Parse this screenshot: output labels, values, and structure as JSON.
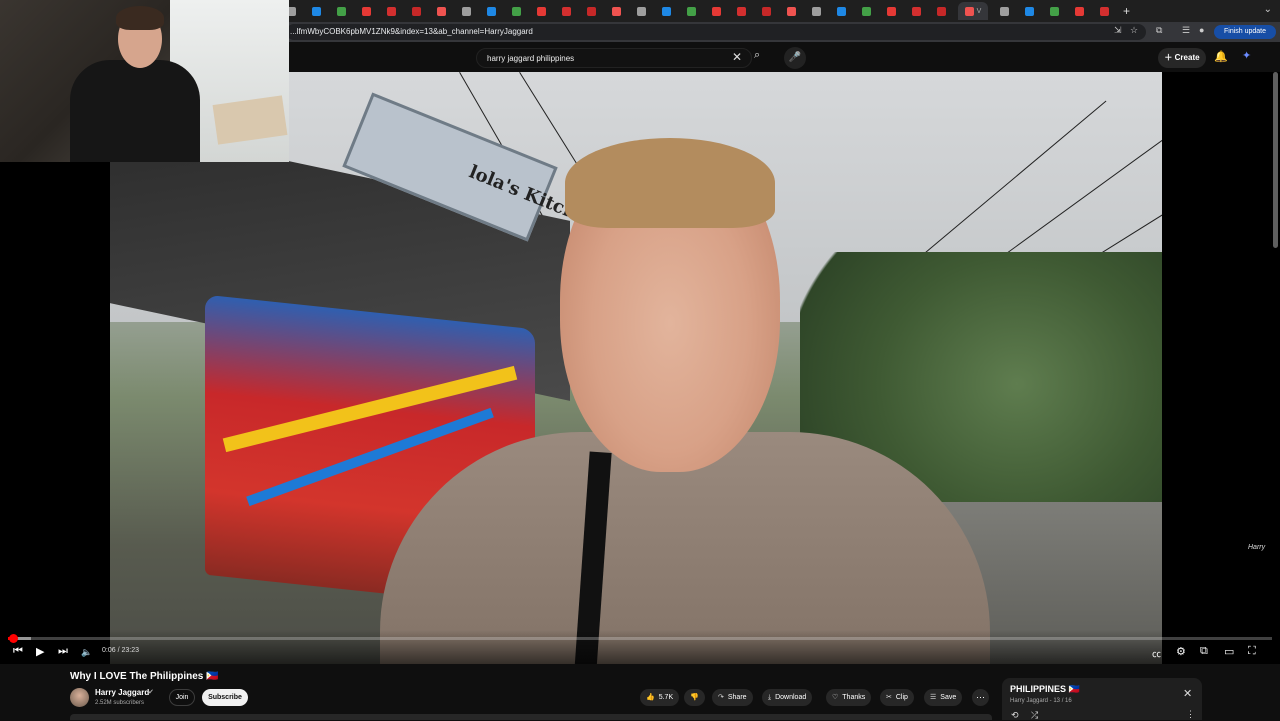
{
  "browser": {
    "tab_count": 44,
    "active_tab_letter": "V",
    "url": "...lfmWbyCOBK6pbMV1ZNk9&index=13&ab_channel=HarryJaggard",
    "finish_update_label": "Finish update"
  },
  "youtube": {
    "search_query": "harry jaggard philippines",
    "create_label": "Create"
  },
  "player": {
    "time_display": "0:06 / 23:23",
    "progress_fraction": 0.0043,
    "buffer_fraction": 0.018,
    "watermark": "Harry",
    "scene_sign_text": "lola's Kitchen & restaurant"
  },
  "video": {
    "title": "Why I LOVE The Philippines 🇵🇭",
    "channel_name": "Harry Jaggard",
    "verified_icon": "verified-check-icon",
    "subscribers": "2.52M subscribers",
    "join_label": "Join",
    "subscribe_label": "Subscribe",
    "like_count": "5.7K",
    "share_label": "Share",
    "download_label": "Download",
    "thanks_label": "Thanks",
    "clip_label": "Clip",
    "save_label": "Save"
  },
  "playlist": {
    "title": "PHILIPPINES 🇵🇭",
    "subtitle": "Harry Jaggard - 13 / 16"
  },
  "colors": {
    "accent": "#ff0000",
    "background": "#0f0f0f",
    "update_button": "#174ea6"
  }
}
